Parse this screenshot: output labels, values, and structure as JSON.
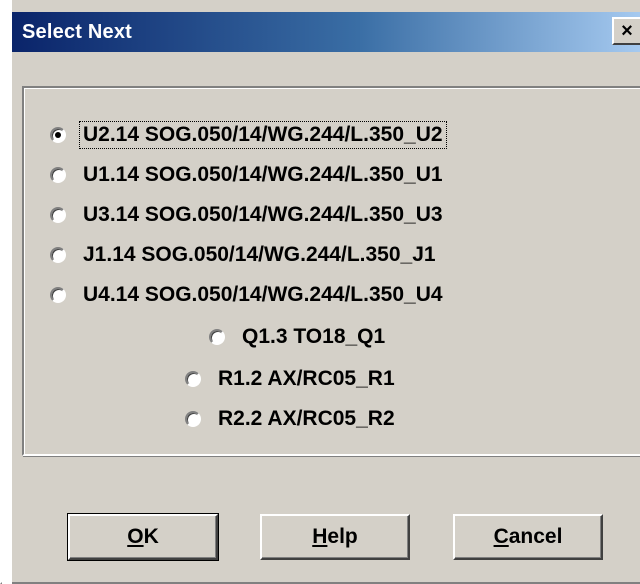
{
  "window": {
    "title": "Select Next",
    "close_glyph": "×",
    "title_bar_colors": [
      "#0a246a",
      "#a6caf0"
    ]
  },
  "options": [
    {
      "label": "U2.14 SOG.050/14/WG.244/L.350_U2",
      "checked": true
    },
    {
      "label": "U1.14 SOG.050/14/WG.244/L.350_U1",
      "checked": false
    },
    {
      "label": "U3.14 SOG.050/14/WG.244/L.350_U3",
      "checked": false
    },
    {
      "label": "J1.14 SOG.050/14/WG.244/L.350_J1",
      "checked": false
    },
    {
      "label": "U4.14 SOG.050/14/WG.244/L.350_U4",
      "checked": false
    },
    {
      "label": "Q1.3 TO18_Q1",
      "checked": false
    },
    {
      "label": "R1.2 AX/RC05_R1",
      "checked": false
    },
    {
      "label": "R2.2 AX/RC05_R2",
      "checked": false
    }
  ],
  "buttons": {
    "ok": {
      "mnemonic": "O",
      "rest": "K"
    },
    "help": {
      "mnemonic": "H",
      "rest": "elp"
    },
    "cancel": {
      "mnemonic": "C",
      "rest": "ancel"
    }
  }
}
